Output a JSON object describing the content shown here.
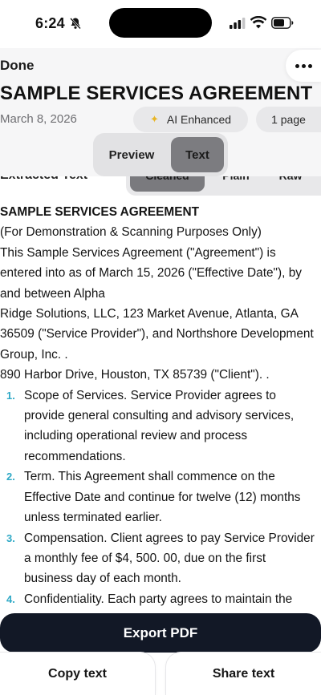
{
  "status": {
    "time": "6:24"
  },
  "header": {
    "done_label": "Done",
    "title": "SAMPLE SERVICES AGREEMENT",
    "date": "March 8, 2026",
    "ai_badge": "AI Enhanced",
    "pages_badge": "1 page"
  },
  "view_toggle": {
    "preview": "Preview",
    "text": "Text",
    "selected": "Text"
  },
  "extracted": {
    "label": "Extracted Text",
    "modes": [
      "Cleaned",
      "Plain",
      "Raw"
    ],
    "selected_mode": "Cleaned"
  },
  "document": {
    "heading": "SAMPLE SERVICES AGREEMENT",
    "lines": [
      "(For Demonstration & Scanning Purposes Only)",
      "This Sample Services Agreement (\"Agreement\") is",
      "entered into as of March 15, 2026 (\"Effective Date\"), by",
      "and between Alpha",
      "Ridge Solutions, LLC, 123 Market Avenue, Atlanta, GA",
      "36509 (\"Service Provider\"), and Northshore Development",
      "Group, Inc. .",
      "890 Harbor Drive, Houston, TX 85739 (\"Client\"). ."
    ],
    "clauses": [
      {
        "num": "1.",
        "lines": [
          "Scope of Services. Service Provider agrees to",
          "provide general consulting and advisory services,",
          "including operational review and process",
          "recommendations."
        ]
      },
      {
        "num": "2.",
        "lines": [
          "Term. This Agreement shall commence on the",
          "Effective Date and continue for twelve (12) months",
          "unless terminated earlier."
        ]
      },
      {
        "num": "3.",
        "lines": [
          "Compensation. Client agrees to pay Service Provider",
          "a monthly fee of $4, 500. 00, due on the first",
          "business day of each month."
        ]
      },
      {
        "num": "4.",
        "lines": [
          "Confidentiality. Each party agrees to maintain the"
        ]
      }
    ]
  },
  "actions": {
    "export": "Export PDF",
    "copy": "Copy text",
    "share": "Share text"
  },
  "colors": {
    "primary_button": "#121826",
    "list_number": "#2fa9c6",
    "sparkle": "#e8b526"
  },
  "icons": [
    "bell-slash-icon",
    "signal-icon",
    "wifi-icon",
    "battery-icon",
    "more-icon",
    "sparkle-icon"
  ]
}
